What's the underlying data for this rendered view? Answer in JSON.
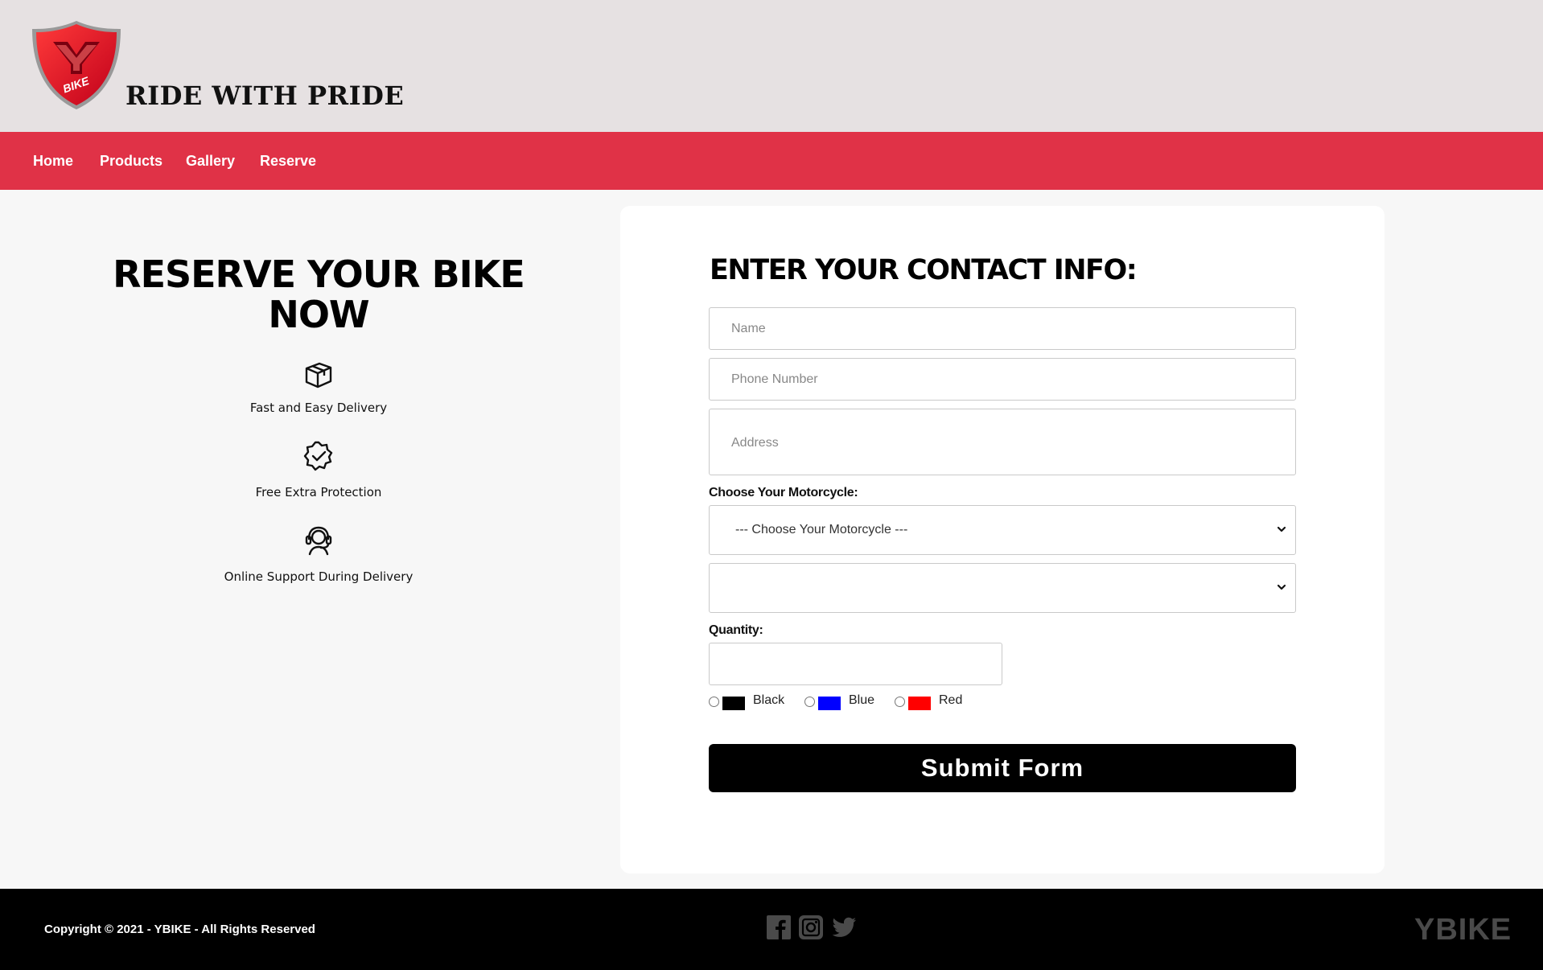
{
  "header": {
    "logo_text": "BIKE",
    "slogan": "RIDE WITH PRIDE"
  },
  "nav": {
    "items": [
      {
        "label": "Home"
      },
      {
        "label": "Products"
      },
      {
        "label": "Gallery"
      },
      {
        "label": "Reserve"
      }
    ]
  },
  "promo": {
    "title": "RESERVE YOUR BIKE NOW",
    "features": [
      {
        "icon": "box-icon",
        "text": "Fast and Easy Delivery"
      },
      {
        "icon": "verified-badge-icon",
        "text": "Free Extra Protection"
      },
      {
        "icon": "support-headset-icon",
        "text": "Online Support During Delivery"
      }
    ]
  },
  "form": {
    "title": "ENTER YOUR CONTACT INFO:",
    "name_placeholder": "Name",
    "phone_placeholder": "Phone Number",
    "address_placeholder": "Address",
    "motorcycle_label": "Choose Your Motorcycle:",
    "motorcycle_selected": "--- Choose Your Motorcycle ---",
    "second_select_value": "",
    "quantity_label": "Quantity:",
    "quantity_value": "",
    "colors": [
      {
        "label": "Black",
        "swatch": "#000000"
      },
      {
        "label": "Blue",
        "swatch": "#0000ff"
      },
      {
        "label": "Red",
        "swatch": "#ff0000"
      }
    ],
    "submit_label": "Submit Form"
  },
  "footer": {
    "copyright": "Copyright © 2021 - YBIKE - All Rights Reserved",
    "social": [
      "facebook-icon",
      "instagram-icon",
      "twitter-icon"
    ],
    "brand": "YBIKE"
  },
  "colors": {
    "header_bg": "#e6e1e2",
    "nav_bg": "#e03247",
    "footer_bg": "#000000",
    "logo_red": "#e8192c"
  }
}
